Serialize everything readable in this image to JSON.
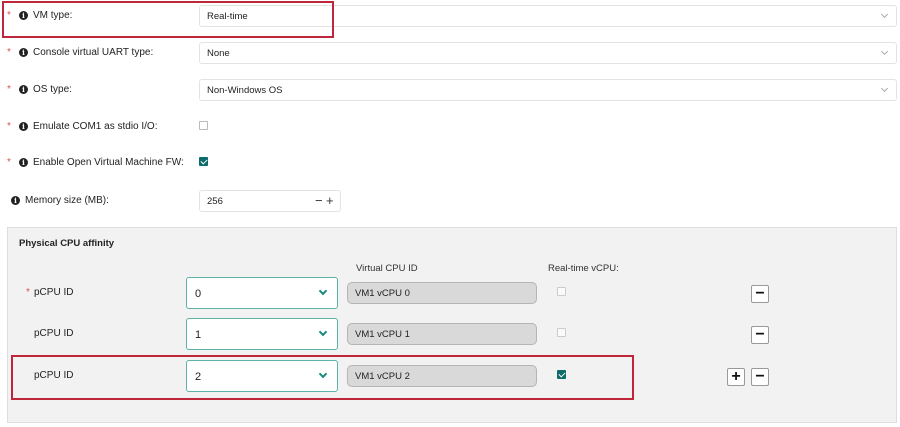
{
  "fields": {
    "vm_type": {
      "required": "*",
      "label": "VM type:",
      "value": "Real-time"
    },
    "console_uart": {
      "required": "*",
      "label": "Console virtual UART type:",
      "value": "None"
    },
    "os_type": {
      "required": "*",
      "label": "OS type:",
      "value": "Non-Windows OS"
    },
    "emulate_com1": {
      "required": "*",
      "label": "Emulate COM1 as stdio I/O:",
      "checked": false
    },
    "open_vm_fw": {
      "required": "*",
      "label": "Enable Open Virtual Machine FW:",
      "checked": true
    },
    "memory": {
      "label": "Memory size (MB):",
      "value": "256",
      "minus": "−",
      "plus": "+"
    }
  },
  "info_icon_glyph": "i",
  "cpu_affinity": {
    "title": "Physical CPU affinity",
    "col_vcpu": "Virtual CPU ID",
    "col_rt": "Real-time vCPU:",
    "rows": [
      {
        "required": "*",
        "label": "pCPU ID",
        "pcpu": "0",
        "vcpu": "VM1 vCPU 0",
        "rt_checked": false,
        "buttons": [
          "−"
        ]
      },
      {
        "required": "",
        "label": "pCPU ID",
        "pcpu": "1",
        "vcpu": "VM1 vCPU 1",
        "rt_checked": false,
        "buttons": [
          "−"
        ]
      },
      {
        "required": "",
        "label": "pCPU ID",
        "pcpu": "2",
        "vcpu": "VM1 vCPU 2",
        "rt_checked": true,
        "buttons": [
          "+",
          "−"
        ]
      }
    ]
  },
  "colors": {
    "accent": "#0d6b6b",
    "required": "#d9534f",
    "highlight": "#c0263a"
  }
}
